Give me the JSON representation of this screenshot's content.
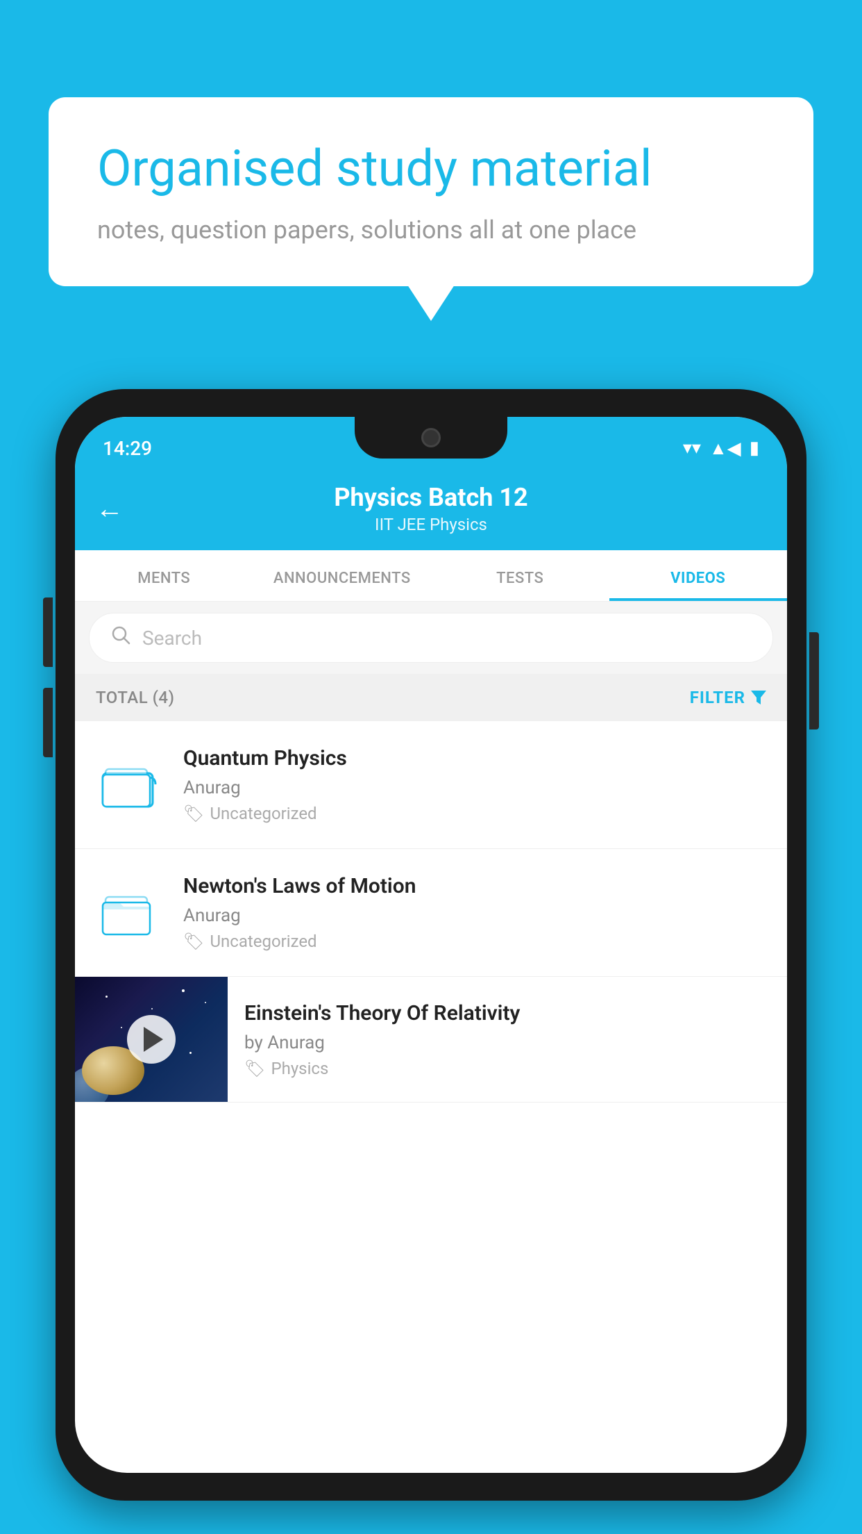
{
  "background_color": "#1ab9e8",
  "bubble": {
    "title": "Organised study material",
    "subtitle": "notes, question papers, solutions all at one place"
  },
  "phone": {
    "status_bar": {
      "time": "14:29",
      "icons": [
        "wifi",
        "signal",
        "battery"
      ]
    },
    "header": {
      "back_label": "←",
      "title": "Physics Batch 12",
      "subtitle": "IIT JEE   Physics"
    },
    "tabs": [
      {
        "label": "MENTS",
        "active": false
      },
      {
        "label": "ANNOUNCEMENTS",
        "active": false
      },
      {
        "label": "TESTS",
        "active": false
      },
      {
        "label": "VIDEOS",
        "active": true
      }
    ],
    "search": {
      "placeholder": "Search"
    },
    "filter_bar": {
      "total_label": "TOTAL (4)",
      "filter_label": "FILTER"
    },
    "videos": [
      {
        "id": "quantum",
        "title": "Quantum Physics",
        "author": "Anurag",
        "tag": "Uncategorized",
        "type": "folder"
      },
      {
        "id": "newton",
        "title": "Newton's Laws of Motion",
        "author": "Anurag",
        "tag": "Uncategorized",
        "type": "folder"
      },
      {
        "id": "einstein",
        "title": "Einstein's Theory Of Relativity",
        "author": "by Anurag",
        "tag": "Physics",
        "type": "video"
      }
    ]
  }
}
